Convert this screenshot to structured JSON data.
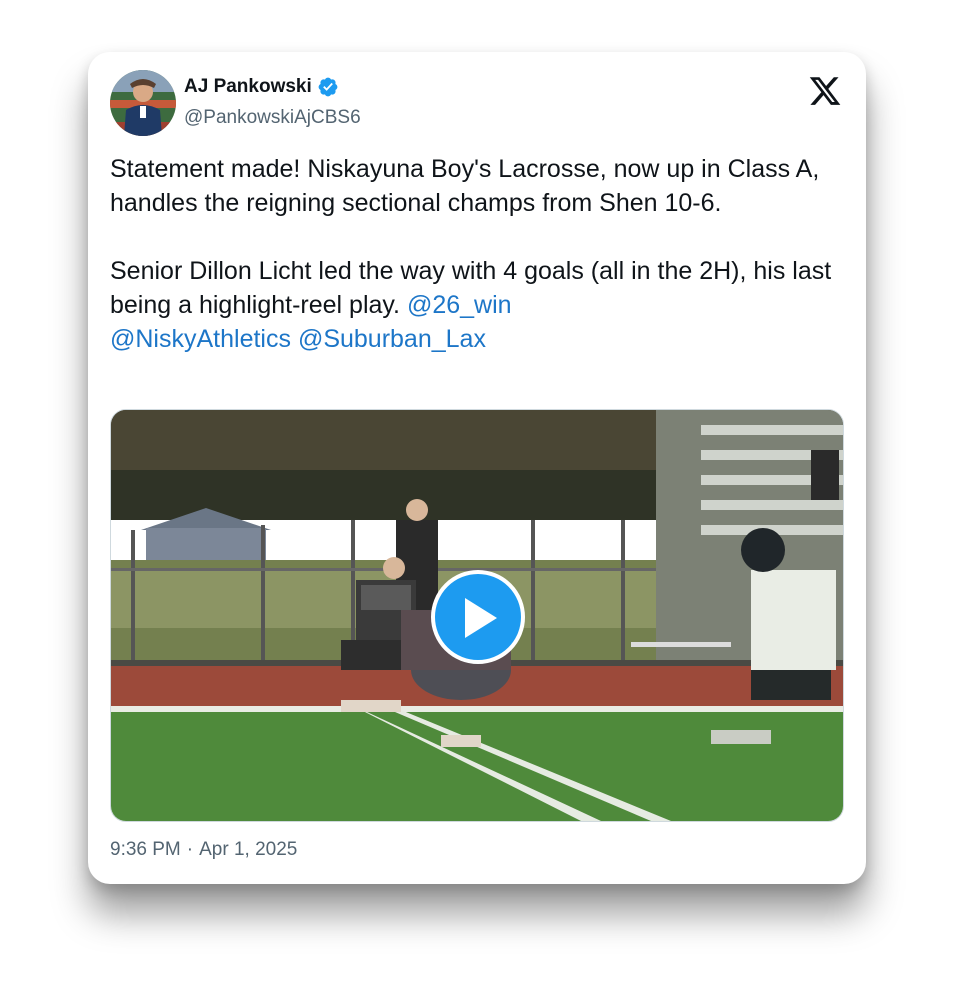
{
  "author": {
    "display_name": "AJ Pankowski",
    "handle": "@PankowskiAjCBS6",
    "verified": true,
    "avatar_icon": "avatar-photo"
  },
  "brand": {
    "logo_icon": "x-logo-icon"
  },
  "tweet": {
    "paragraph1": "Statement made! Niskayuna Boy's Lacrosse, now up in Class A, handles the reigning sectional champs from Shen 10-6.",
    "paragraph2_text": "Senior Dillon Licht led the way with 4 goals (all in the 2H), his last being a highlight-reel play. ",
    "mentions": [
      "@26_win",
      "@NiskyAthletics",
      "@Suburban_Lax"
    ]
  },
  "media": {
    "type": "video",
    "play_icon": "play-icon"
  },
  "footer": {
    "time": "9:36 PM",
    "separator": "·",
    "date": "Apr 1, 2025"
  },
  "colors": {
    "verified_blue": "#1d9bf0",
    "mention_blue": "#1d76c8",
    "text": "#0f1419",
    "muted": "#536471"
  }
}
